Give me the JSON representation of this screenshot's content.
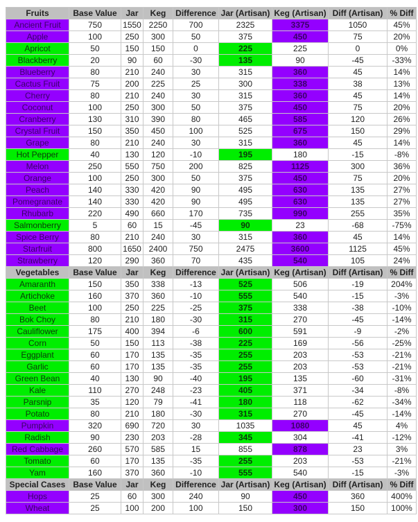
{
  "colors": {
    "purple": "#9400ff",
    "green": "#00ee00",
    "header": "#c0c0c0"
  },
  "columns": [
    "Base Value",
    "Jar",
    "Keg",
    "Difference",
    "Jar (Artisan)",
    "Keg (Artisan)",
    "Diff (Artisan)",
    "% Diff"
  ],
  "sections": [
    {
      "title": "Fruits",
      "rows": [
        {
          "name": "Ancient Fruit",
          "hl": "purple",
          "v": [
            "750",
            "1550",
            "2250",
            "700",
            "2325",
            "3375",
            "1050",
            "45%"
          ]
        },
        {
          "name": "Apple",
          "hl": "purple",
          "v": [
            "100",
            "250",
            "300",
            "50",
            "375",
            "450",
            "75",
            "20%"
          ]
        },
        {
          "name": "Apricot",
          "hl": "green",
          "v": [
            "50",
            "150",
            "150",
            "0",
            "225",
            "225",
            "0",
            "0%"
          ]
        },
        {
          "name": "Blackberry",
          "hl": "green",
          "v": [
            "20",
            "90",
            "60",
            "-30",
            "135",
            "90",
            "-45",
            "-33%"
          ]
        },
        {
          "name": "Blueberry",
          "hl": "purple",
          "v": [
            "80",
            "210",
            "240",
            "30",
            "315",
            "360",
            "45",
            "14%"
          ]
        },
        {
          "name": "Cactus Fruit",
          "hl": "purple",
          "v": [
            "75",
            "200",
            "225",
            "25",
            "300",
            "338",
            "38",
            "13%"
          ]
        },
        {
          "name": "Cherry",
          "hl": "purple",
          "v": [
            "80",
            "210",
            "240",
            "30",
            "315",
            "360",
            "45",
            "14%"
          ]
        },
        {
          "name": "Coconut",
          "hl": "purple",
          "v": [
            "100",
            "250",
            "300",
            "50",
            "375",
            "450",
            "75",
            "20%"
          ]
        },
        {
          "name": "Cranberry",
          "hl": "purple",
          "v": [
            "130",
            "310",
            "390",
            "80",
            "465",
            "585",
            "120",
            "26%"
          ]
        },
        {
          "name": "Crystal Fruit",
          "hl": "purple",
          "v": [
            "150",
            "350",
            "450",
            "100",
            "525",
            "675",
            "150",
            "29%"
          ]
        },
        {
          "name": "Grape",
          "hl": "purple",
          "v": [
            "80",
            "210",
            "240",
            "30",
            "315",
            "360",
            "45",
            "14%"
          ]
        },
        {
          "name": "Hot Pepper",
          "hl": "green",
          "v": [
            "40",
            "130",
            "120",
            "-10",
            "195",
            "180",
            "-15",
            "-8%"
          ]
        },
        {
          "name": "Melon",
          "hl": "purple",
          "v": [
            "250",
            "550",
            "750",
            "200",
            "825",
            "1125",
            "300",
            "36%"
          ]
        },
        {
          "name": "Orange",
          "hl": "purple",
          "v": [
            "100",
            "250",
            "300",
            "50",
            "375",
            "450",
            "75",
            "20%"
          ]
        },
        {
          "name": "Peach",
          "hl": "purple",
          "v": [
            "140",
            "330",
            "420",
            "90",
            "495",
            "630",
            "135",
            "27%"
          ]
        },
        {
          "name": "Pomegranate",
          "hl": "purple",
          "v": [
            "140",
            "330",
            "420",
            "90",
            "495",
            "630",
            "135",
            "27%"
          ]
        },
        {
          "name": "Rhubarb",
          "hl": "purple",
          "v": [
            "220",
            "490",
            "660",
            "170",
            "735",
            "990",
            "255",
            "35%"
          ]
        },
        {
          "name": "Salmonberry",
          "hl": "green",
          "v": [
            "5",
            "60",
            "15",
            "-45",
            "90",
            "23",
            "-68",
            "-75%"
          ]
        },
        {
          "name": "Spice Berry",
          "hl": "purple",
          "v": [
            "80",
            "210",
            "240",
            "30",
            "315",
            "360",
            "45",
            "14%"
          ]
        },
        {
          "name": "Starfruit",
          "hl": "purple",
          "v": [
            "800",
            "1650",
            "2400",
            "750",
            "2475",
            "3600",
            "1125",
            "45%"
          ]
        },
        {
          "name": "Strawberry",
          "hl": "purple",
          "v": [
            "120",
            "290",
            "360",
            "70",
            "435",
            "540",
            "105",
            "24%"
          ]
        }
      ]
    },
    {
      "title": "Vegetables",
      "rows": [
        {
          "name": "Amaranth",
          "hl": "green",
          "v": [
            "150",
            "350",
            "338",
            "-13",
            "525",
            "506",
            "-19",
            "204%"
          ]
        },
        {
          "name": "Artichoke",
          "hl": "green",
          "v": [
            "160",
            "370",
            "360",
            "-10",
            "555",
            "540",
            "-15",
            "-3%"
          ]
        },
        {
          "name": "Beet",
          "hl": "green",
          "v": [
            "100",
            "250",
            "225",
            "-25",
            "375",
            "338",
            "-38",
            "-10%"
          ]
        },
        {
          "name": "Bok Choy",
          "hl": "green",
          "v": [
            "80",
            "210",
            "180",
            "-30",
            "315",
            "270",
            "-45",
            "-14%"
          ]
        },
        {
          "name": "Cauliflower",
          "hl": "green",
          "v": [
            "175",
            "400",
            "394",
            "-6",
            "600",
            "591",
            "-9",
            "-2%"
          ]
        },
        {
          "name": "Corn",
          "hl": "green",
          "v": [
            "50",
            "150",
            "113",
            "-38",
            "225",
            "169",
            "-56",
            "-25%"
          ]
        },
        {
          "name": "Eggplant",
          "hl": "green",
          "v": [
            "60",
            "170",
            "135",
            "-35",
            "255",
            "203",
            "-53",
            "-21%"
          ]
        },
        {
          "name": "Garlic",
          "hl": "green",
          "v": [
            "60",
            "170",
            "135",
            "-35",
            "255",
            "203",
            "-53",
            "-21%"
          ]
        },
        {
          "name": "Green Bean",
          "hl": "green",
          "v": [
            "40",
            "130",
            "90",
            "-40",
            "195",
            "135",
            "-60",
            "-31%"
          ]
        },
        {
          "name": "Kale",
          "hl": "green",
          "v": [
            "110",
            "270",
            "248",
            "-23",
            "405",
            "371",
            "-34",
            "-8%"
          ]
        },
        {
          "name": "Parsnip",
          "hl": "green",
          "v": [
            "35",
            "120",
            "79",
            "-41",
            "180",
            "118",
            "-62",
            "-34%"
          ]
        },
        {
          "name": "Potato",
          "hl": "green",
          "v": [
            "80",
            "210",
            "180",
            "-30",
            "315",
            "270",
            "-45",
            "-14%"
          ]
        },
        {
          "name": "Pumpkin",
          "hl": "purple",
          "v": [
            "320",
            "690",
            "720",
            "30",
            "1035",
            "1080",
            "45",
            "4%"
          ]
        },
        {
          "name": "Radish",
          "hl": "green",
          "v": [
            "90",
            "230",
            "203",
            "-28",
            "345",
            "304",
            "-41",
            "-12%"
          ]
        },
        {
          "name": "Red Cabbage",
          "hl": "purple",
          "v": [
            "260",
            "570",
            "585",
            "15",
            "855",
            "878",
            "23",
            "3%"
          ]
        },
        {
          "name": "Tomato",
          "hl": "green",
          "v": [
            "60",
            "170",
            "135",
            "-35",
            "255",
            "203",
            "-53",
            "-21%"
          ]
        },
        {
          "name": "Yam",
          "hl": "green",
          "v": [
            "160",
            "370",
            "360",
            "-10",
            "555",
            "540",
            "-15",
            "-3%"
          ]
        }
      ]
    },
    {
      "title": "Special Cases",
      "rows": [
        {
          "name": "Hops",
          "hl": "purple",
          "v": [
            "25",
            "60",
            "300",
            "240",
            "90",
            "450",
            "360",
            "400%"
          ]
        },
        {
          "name": "Wheat",
          "hl": "purple",
          "v": [
            "25",
            "100",
            "200",
            "100",
            "150",
            "300",
            "150",
            "100%"
          ]
        }
      ]
    }
  ]
}
